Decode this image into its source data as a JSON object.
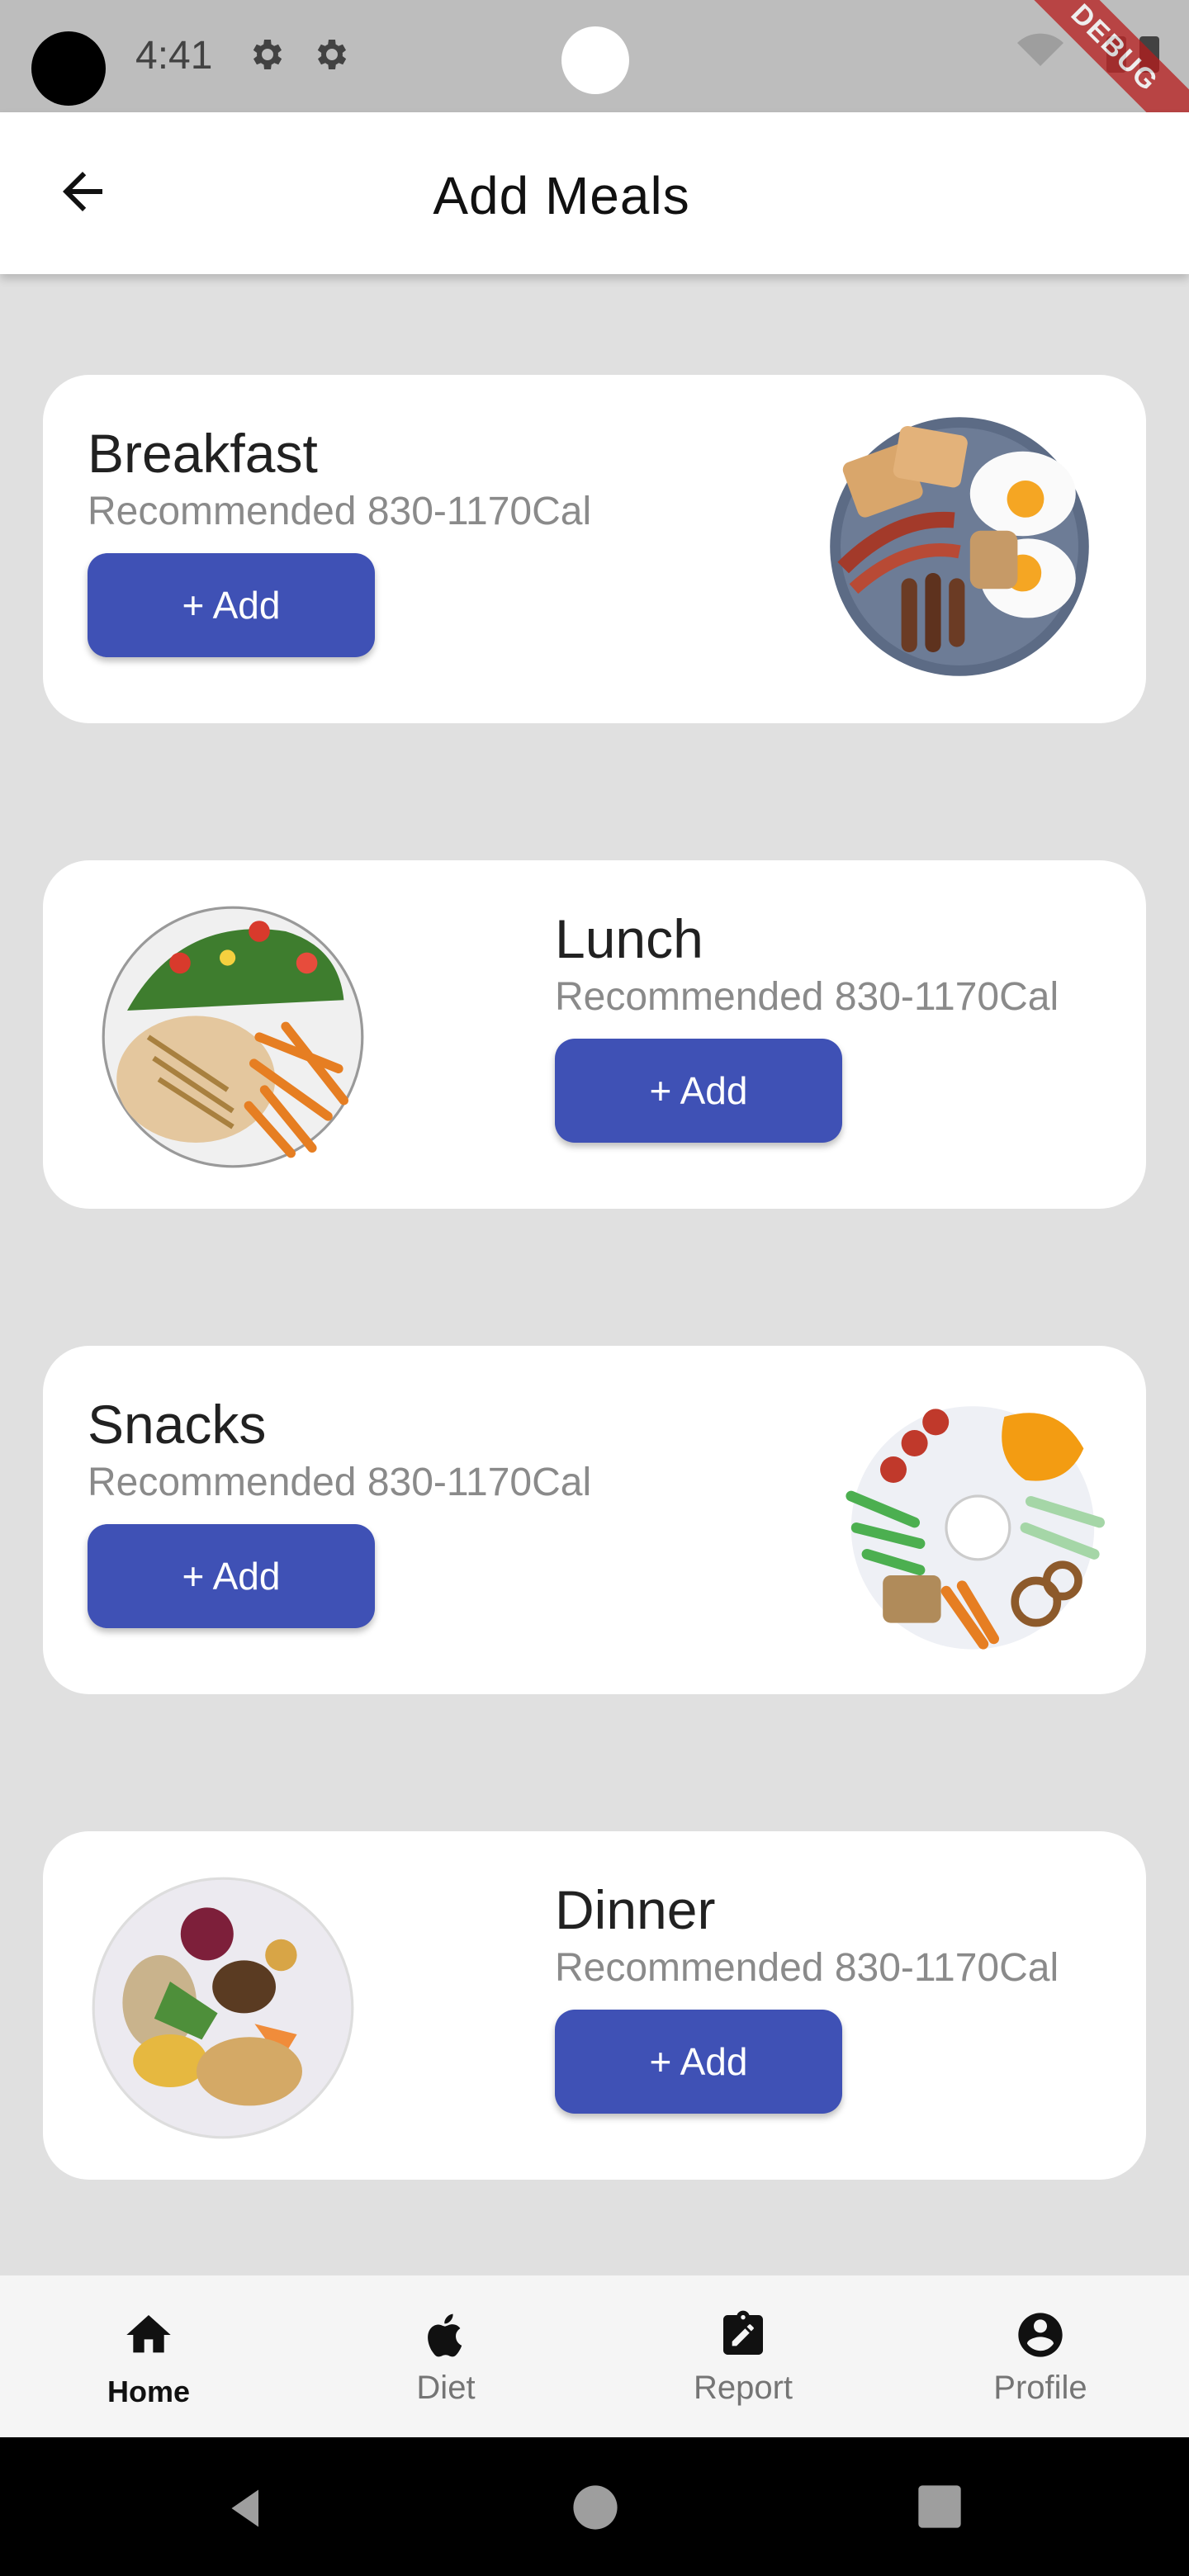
{
  "status_bar": {
    "time": "4:41",
    "debug_banner": "DEBUG"
  },
  "app_bar": {
    "title": "Add Meals"
  },
  "meals": [
    {
      "title": "Breakfast",
      "subtitle": "Recommended 830-1170Cal",
      "button": "+ Add",
      "image": "breakfast-plate"
    },
    {
      "title": "Lunch",
      "subtitle": "Recommended 830-1170Cal",
      "button": "+ Add",
      "image": "lunch-plate"
    },
    {
      "title": "Snacks",
      "subtitle": "Recommended 830-1170Cal",
      "button": "+ Add",
      "image": "snacks-plate"
    },
    {
      "title": "Dinner",
      "subtitle": "Recommended 830-1170Cal",
      "button": "+ Add",
      "image": "dinner-plate"
    }
  ],
  "bottom_nav": {
    "items": [
      {
        "label": "Home",
        "icon": "home-icon",
        "active": true
      },
      {
        "label": "Diet",
        "icon": "apple-icon",
        "active": false
      },
      {
        "label": "Report",
        "icon": "report-icon",
        "active": false
      },
      {
        "label": "Profile",
        "icon": "profile-icon",
        "active": false
      }
    ]
  },
  "colors": {
    "accent": "#3f51b5",
    "background": "#e0e0e0",
    "card": "#ffffff"
  }
}
